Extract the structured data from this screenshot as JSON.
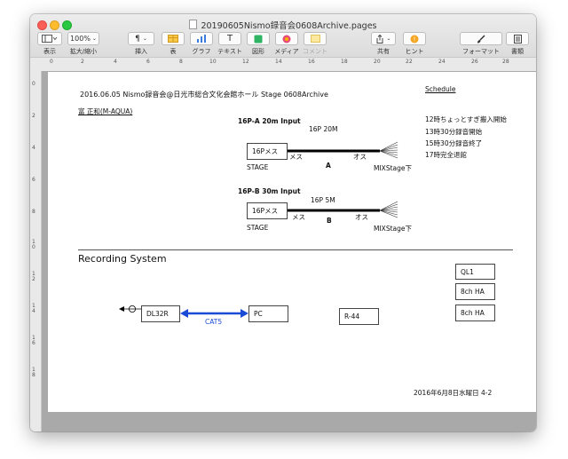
{
  "window": {
    "title": "20190605Nismo録音会0608Archive.pages"
  },
  "toolbar": {
    "view_label": "表示",
    "zoom_value": "100%",
    "zoom_label": "拡大/縮小",
    "insert_label": "挿入",
    "table_label": "表",
    "chart_label": "グラフ",
    "text_label": "テキスト",
    "shape_label": "図形",
    "media_label": "メディア",
    "comment_label": "コメント",
    "share_label": "共有",
    "tips_label": "ヒント",
    "format_label": "フォーマット",
    "document_label": "書類",
    "insert_icon_glyph": "¶",
    "text_icon_glyph": "T"
  },
  "ruler": {
    "marks": [
      "0",
      "2",
      "4",
      "6",
      "8",
      "10",
      "12",
      "14",
      "16",
      "18",
      "20",
      "22",
      "24",
      "26",
      "28"
    ],
    "vmarks": [
      "0",
      "2",
      "4",
      "6",
      "8",
      "1 0",
      "1 2",
      "1 4",
      "1 6",
      "1 8"
    ]
  },
  "doc": {
    "header_line": "2016.06.05 Nismo録音会@日光市総合文化会館ホール Stage 0608Archive",
    "author": "富 正和(M-AQUA)",
    "schedule_title": "Schedule",
    "schedule": [
      "12時ちょっとすぎ搬入開始",
      "13時30分録音開始",
      "15時30分録音終了",
      "17時完全退館"
    ],
    "cable_a": {
      "title": "16P-A 20m Input",
      "length": "16P 20M",
      "box": "16Pメス",
      "female": "メス",
      "male": "オス",
      "letter": "A",
      "left": "STAGE",
      "right": "MIXStage下"
    },
    "cable_b": {
      "title": "16P-B 30m Input",
      "length": "16P 5M",
      "box": "16Pメス",
      "female": "メス",
      "male": "オス",
      "letter": "B",
      "left": "STAGE",
      "right": "MIXStage下"
    },
    "recording_title": "Recording System",
    "dl32r": "DL32R",
    "pc": "PC",
    "cat5": "CAT5",
    "r44": "R-44",
    "ql1": "QL1",
    "ha1": "8ch HA",
    "ha2": "8ch HA",
    "footer": "2016年6月8日水曜日 4-2"
  },
  "colors": {
    "link": "#1a4bd6",
    "close": "#fc5f57",
    "minimize": "#fdbc2e",
    "maximize": "#28c840"
  }
}
